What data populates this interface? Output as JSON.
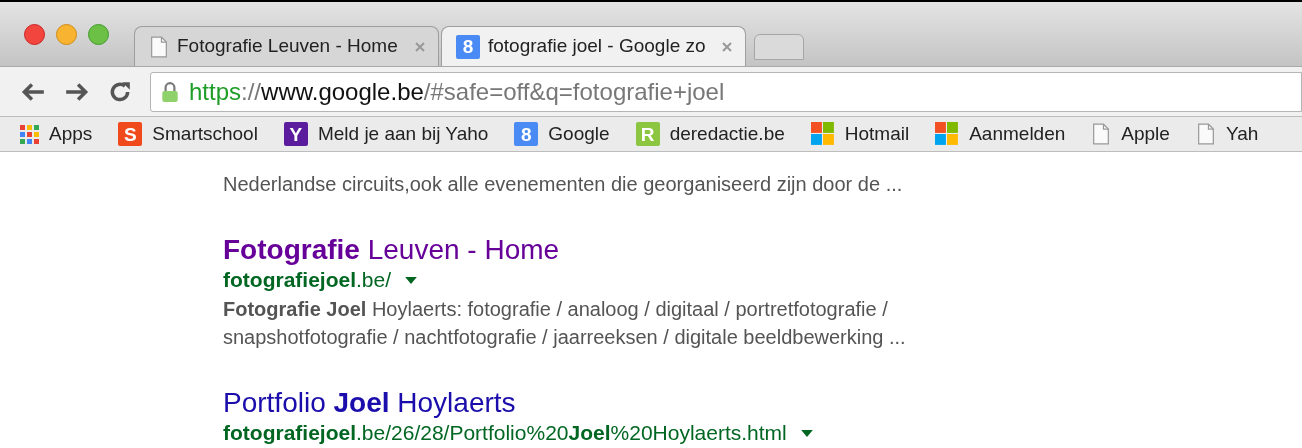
{
  "tabs": [
    {
      "title": "Fotografie Leuven - Home",
      "favicon": {
        "kind": "page"
      },
      "selected": false
    },
    {
      "title": "fotografie joel - Google zo",
      "favicon": {
        "kind": "letter",
        "letter": "8",
        "color": "#4a8af4"
      },
      "selected": true
    }
  ],
  "address_bar": {
    "scheme": "https",
    "separator": "://",
    "host": "www.google.be",
    "path": "/#safe=off&q=fotografie+joel"
  },
  "bookmarks": [
    {
      "label": "Apps",
      "icon": {
        "kind": "apps"
      }
    },
    {
      "label": "Smartschool",
      "icon": {
        "kind": "letter",
        "letter": "S",
        "color": "#f0491c"
      }
    },
    {
      "label": "Meld je aan bij Yaho",
      "icon": {
        "kind": "letter",
        "letter": "Y",
        "color": "#5b1c9e"
      }
    },
    {
      "label": "Google",
      "icon": {
        "kind": "letter",
        "letter": "8",
        "color": "#4a8af4"
      }
    },
    {
      "label": "deredactie.be",
      "icon": {
        "kind": "letter",
        "letter": "R",
        "color": "#8cc53f"
      }
    },
    {
      "label": "Hotmail",
      "icon": {
        "kind": "windows"
      }
    },
    {
      "label": "Aanmelden",
      "icon": {
        "kind": "windows"
      }
    },
    {
      "label": "Apple",
      "icon": {
        "kind": "page"
      }
    },
    {
      "label": "Yah",
      "icon": {
        "kind": "page"
      }
    }
  ],
  "results": [
    {
      "snippet": [
        "Nederlandse circuits,ook alle evenementen die georganiseerd zijn door de ..."
      ]
    },
    {
      "title": "**Fotografie** Leuven - Home",
      "visited": true,
      "url": "**fotografiejoel**.be/",
      "snippet": [
        "**Fotografie Joel** Hoylaerts: fotografie / analoog / digitaal / portretfotografie /",
        "snapshotfotografie / nachtfotografie / jaarreeksen / digitale beeldbewerking ..."
      ]
    },
    {
      "title": "Portfolio **Joel** Hoylaerts",
      "visited": false,
      "url": "**fotografiejoel**.be/26/28/Portfolio%20**Joel**%20Hoylaerts.html"
    }
  ]
}
